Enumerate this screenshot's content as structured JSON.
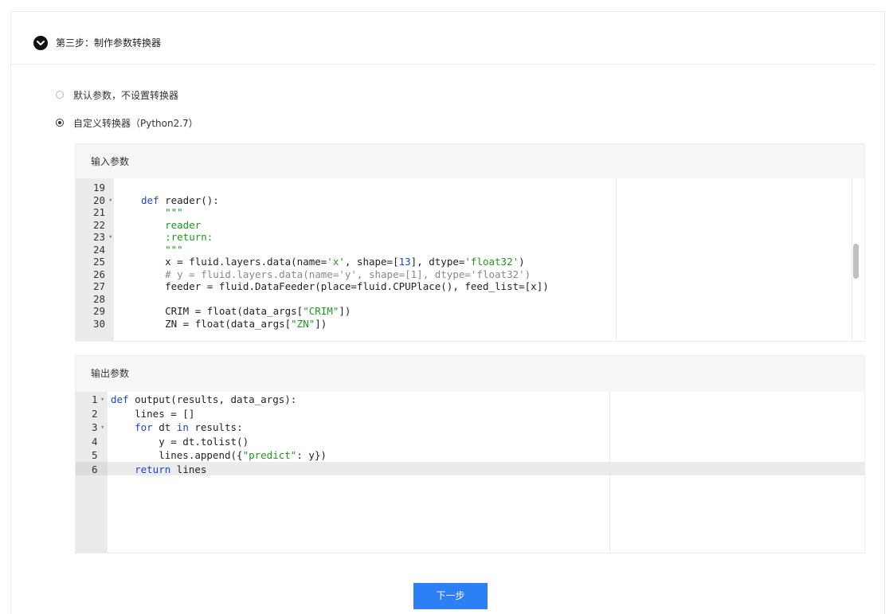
{
  "step": {
    "title": "第三步：制作参数转换器"
  },
  "options": [
    {
      "label": "默认参数，不设置转换器",
      "checked": false
    },
    {
      "label": "自定义转换器（Python2.7）",
      "checked": true
    }
  ],
  "input_panel": {
    "title": "输入参数",
    "lines": [
      {
        "n": "19",
        "fold": false,
        "code": ""
      },
      {
        "n": "20",
        "fold": true,
        "code": "def reader():"
      },
      {
        "n": "21",
        "fold": false,
        "code": "    \"\"\""
      },
      {
        "n": "22",
        "fold": false,
        "code": "    reader"
      },
      {
        "n": "23",
        "fold": true,
        "code": "    :return:"
      },
      {
        "n": "24",
        "fold": false,
        "code": "    \"\"\""
      },
      {
        "n": "25",
        "fold": false,
        "code": "    x = fluid.layers.data(name='x', shape=[13], dtype='float32')"
      },
      {
        "n": "26",
        "fold": false,
        "code": "    # y = fluid.layers.data(name='y', shape=[1], dtype='float32')"
      },
      {
        "n": "27",
        "fold": false,
        "code": "    feeder = fluid.DataFeeder(place=fluid.CPUPlace(), feed_list=[x])"
      },
      {
        "n": "28",
        "fold": false,
        "code": ""
      },
      {
        "n": "29",
        "fold": false,
        "code": "    CRIM = float(data_args[\"CRIM\"])"
      },
      {
        "n": "30",
        "fold": false,
        "code": "    ZN = float(data_args[\"ZN\"])"
      }
    ]
  },
  "output_panel": {
    "title": "输出参数",
    "lines": [
      {
        "n": "1",
        "fold": true,
        "code": "def output(results, data_args):"
      },
      {
        "n": "2",
        "fold": false,
        "code": "    lines = []"
      },
      {
        "n": "3",
        "fold": true,
        "code": "    for dt in results:"
      },
      {
        "n": "4",
        "fold": false,
        "code": "        y = dt.tolist()"
      },
      {
        "n": "5",
        "fold": false,
        "code": "        lines.append({\"predict\": y})"
      },
      {
        "n": "6",
        "fold": false,
        "code": "    return lines"
      }
    ]
  },
  "next_button": {
    "label": "下一步"
  },
  "colors": {
    "keyword": "#1a44d4",
    "string": "#1a9a1a",
    "comment": "#888888",
    "primary_button": "#2d7ff6"
  }
}
